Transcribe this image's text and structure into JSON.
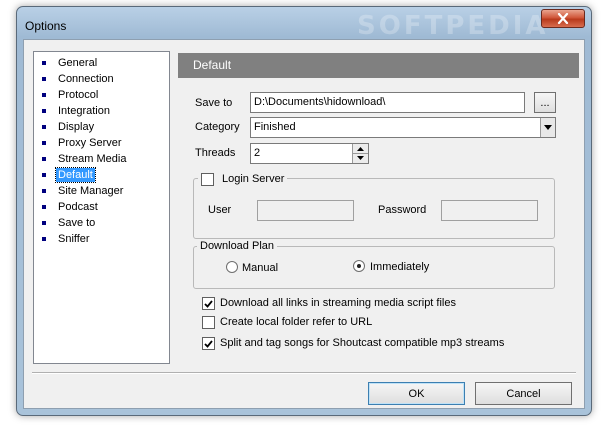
{
  "window": {
    "title": "Options",
    "watermark": "SOFTPEDIA"
  },
  "sidebar": {
    "items": [
      {
        "label": "General"
      },
      {
        "label": "Connection"
      },
      {
        "label": "Protocol"
      },
      {
        "label": "Integration"
      },
      {
        "label": "Display"
      },
      {
        "label": "Proxy Server"
      },
      {
        "label": "Stream Media"
      },
      {
        "label": "Default",
        "selected": true
      },
      {
        "label": "Site Manager"
      },
      {
        "label": "Podcast"
      },
      {
        "label": "Save to"
      },
      {
        "label": "Sniffer"
      }
    ]
  },
  "panel": {
    "header": "Default",
    "save_to": {
      "label": "Save to",
      "value": "D:\\Documents\\hidownload\\",
      "browse_label": "..."
    },
    "category": {
      "label": "Category",
      "value": "Finished"
    },
    "threads": {
      "label": "Threads",
      "value": "2"
    },
    "login": {
      "label": "Login Server",
      "checked": false,
      "user_label": "User",
      "user_value": "",
      "password_label": "Password",
      "password_value": ""
    },
    "plan": {
      "legend": "Download Plan",
      "manual_label": "Manual",
      "manual_selected": false,
      "immediately_label": "Immediately",
      "immediately_selected": true
    },
    "options": [
      {
        "label": "Download all links in streaming media script files",
        "checked": true
      },
      {
        "label": "Create local folder refer to URL",
        "checked": false
      },
      {
        "label": "Split and tag songs for Shoutcast compatible mp3 streams",
        "checked": true
      }
    ]
  },
  "footer": {
    "ok_label": "OK",
    "cancel_label": "Cancel"
  }
}
